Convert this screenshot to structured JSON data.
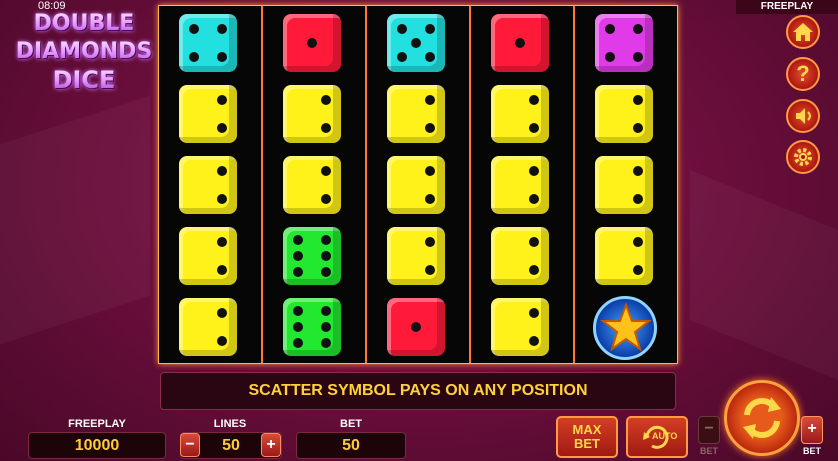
{
  "status": {
    "time": "08:09",
    "mode_badge": "FREEPLAY"
  },
  "logo": {
    "line1": "DOUBLE",
    "line2": "DIAMONDS",
    "line3": "DICE"
  },
  "colors": {
    "reel_border": "#ff7a2a",
    "message_text": "#ffd23a",
    "value_text": "#ffcc33",
    "die_yellow": "#fff21a",
    "die_cyan": "#22e0e0",
    "die_red": "#ff1a3a",
    "die_green": "#22e830",
    "die_magenta": "#e13ae8"
  },
  "reels": [
    [
      {
        "symbol": "cyan-die",
        "pips": 4
      },
      {
        "symbol": "yellow-die",
        "pips": 2
      },
      {
        "symbol": "yellow-die",
        "pips": 2
      },
      {
        "symbol": "yellow-die",
        "pips": 2
      },
      {
        "symbol": "yellow-die",
        "pips": 2
      }
    ],
    [
      {
        "symbol": "red-die",
        "pips": 1
      },
      {
        "symbol": "yellow-die",
        "pips": 2
      },
      {
        "symbol": "yellow-die",
        "pips": 2
      },
      {
        "symbol": "green-die",
        "pips": 6
      },
      {
        "symbol": "green-die",
        "pips": 6
      }
    ],
    [
      {
        "symbol": "cyan-die",
        "pips": 5
      },
      {
        "symbol": "yellow-die",
        "pips": 2
      },
      {
        "symbol": "yellow-die",
        "pips": 2
      },
      {
        "symbol": "yellow-die",
        "pips": 2
      },
      {
        "symbol": "red-die",
        "pips": 1
      }
    ],
    [
      {
        "symbol": "red-die",
        "pips": 1
      },
      {
        "symbol": "yellow-die",
        "pips": 2
      },
      {
        "symbol": "yellow-die",
        "pips": 2
      },
      {
        "symbol": "yellow-die",
        "pips": 2
      },
      {
        "symbol": "yellow-die",
        "pips": 2
      }
    ],
    [
      {
        "symbol": "magenta-die",
        "pips": 4
      },
      {
        "symbol": "yellow-die",
        "pips": 2
      },
      {
        "symbol": "yellow-die",
        "pips": 2
      },
      {
        "symbol": "yellow-die",
        "pips": 2
      },
      {
        "symbol": "scatter-star",
        "pips": 0
      }
    ]
  ],
  "message": "SCATTER SYMBOL PAYS ON ANY POSITION",
  "freeplay": {
    "label": "FREEPLAY",
    "value": "10000"
  },
  "lines": {
    "label": "LINES",
    "value": "50",
    "minus": "−",
    "plus": "+"
  },
  "bet": {
    "label": "BET",
    "value": "50"
  },
  "maxbet": {
    "line1": "MAX",
    "line2": "BET"
  },
  "auto_label": "AUTO",
  "bet_minus": {
    "symbol": "−",
    "label": "BET"
  },
  "bet_plus": {
    "symbol": "+",
    "label": "BET"
  },
  "side_buttons": [
    "home-icon",
    "help-icon",
    "sound-icon",
    "settings-icon"
  ]
}
